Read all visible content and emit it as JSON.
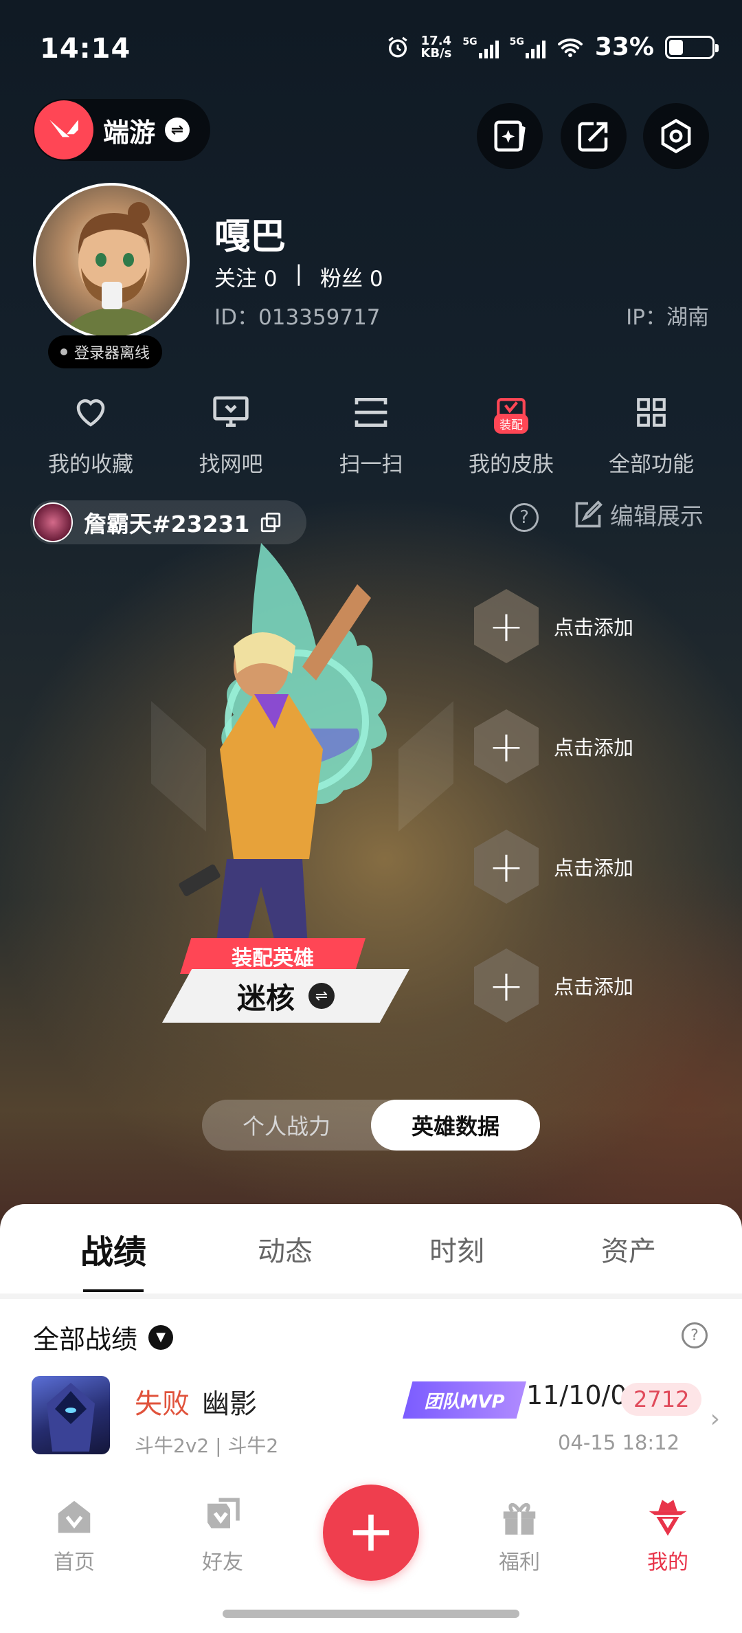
{
  "status_bar": {
    "time": "14:14",
    "net_speed_top": "17.4",
    "net_speed_unit": "KB/s",
    "sim1": "5G",
    "sim2": "5G",
    "battery": "33%",
    "battery_level": 0.33
  },
  "top_bar": {
    "app_name": "端游"
  },
  "profile": {
    "username": "嘎巴",
    "following": "关注 0",
    "separator": "|",
    "followers": "粉丝 0",
    "id": "ID：013359717",
    "ip": "IP：湖南",
    "launcher_status": "登录器离线"
  },
  "functions": [
    {
      "label": "我的收藏",
      "icon": "heart-icon"
    },
    {
      "label": "找网吧",
      "icon": "monitor-icon"
    },
    {
      "label": "扫一扫",
      "icon": "scan-icon"
    },
    {
      "label": "我的皮肤",
      "icon": "skin-icon",
      "badge": "装配"
    },
    {
      "label": "全部功能",
      "icon": "grid-icon"
    }
  ],
  "player_tag": {
    "name": "詹霸天#23231"
  },
  "edit_display": "编辑展示",
  "slots": [
    {
      "label": "点击添加"
    },
    {
      "label": "点击添加"
    },
    {
      "label": "点击添加"
    },
    {
      "label": "点击添加"
    }
  ],
  "equipped": {
    "badge": "装配英雄",
    "hero": "迷核"
  },
  "segments": {
    "personal": "个人战力",
    "hero_data": "英雄数据",
    "active": "hero_data"
  },
  "tabs": [
    {
      "label": "战绩",
      "active": true
    },
    {
      "label": "动态",
      "active": false
    },
    {
      "label": "时刻",
      "active": false
    },
    {
      "label": "资产",
      "active": false
    }
  ],
  "records": {
    "header": "全部战绩",
    "matches": [
      {
        "result": "失败",
        "hero": "幽影",
        "mode": "斗牛2v2 | 斗牛2",
        "mvp": "团队MVP",
        "kda": "11/10/0",
        "score": "2712",
        "time": "04-15 18:12"
      }
    ]
  },
  "nav": [
    {
      "label": "首页",
      "active": false
    },
    {
      "label": "好友",
      "active": false
    },
    {
      "label": "福利",
      "active": false
    },
    {
      "label": "我的",
      "active": true
    }
  ],
  "colors": {
    "accent": "#ff4655",
    "loss": "#e0533c",
    "mvp": "#8b6bff",
    "active_nav": "#e8344a"
  }
}
